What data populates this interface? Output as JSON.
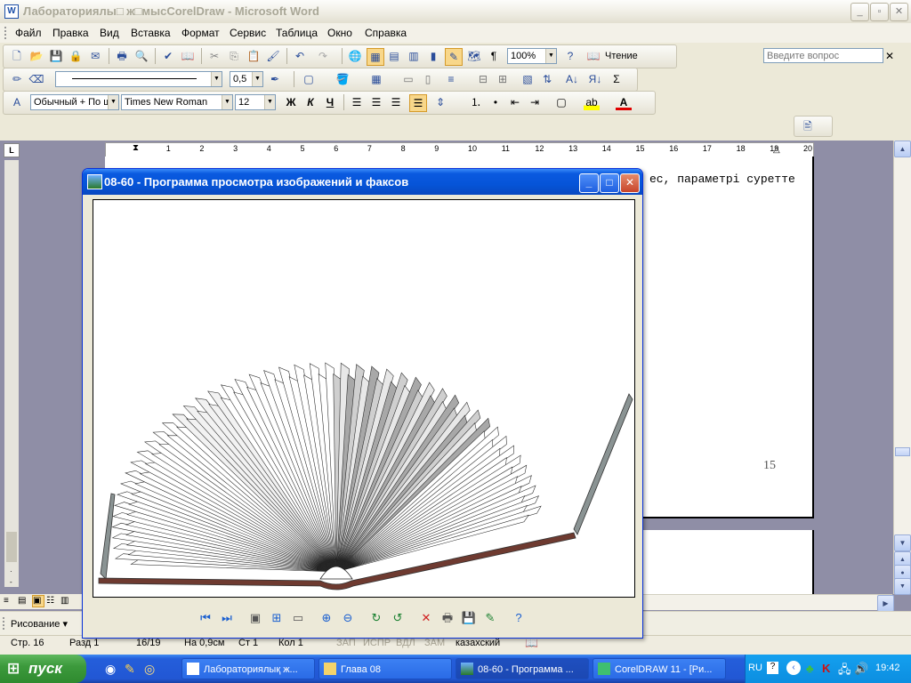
{
  "word": {
    "title": "Лабораториялы□ ж□мысCorelDraw - Microsoft Word",
    "menu": [
      "Файл",
      "Правка",
      "Вид",
      "Вставка",
      "Формат",
      "Сервис",
      "Таблица",
      "Окно",
      "Справка"
    ],
    "ask_placeholder": "Введите вопрос",
    "zoom": "100%",
    "reading_label": "Чтение",
    "line_weight": "0,5",
    "style": "Обычный + По ш",
    "font": "Times New Roman",
    "font_size": "12",
    "drawing_label": "Рисование ▾",
    "ruler_numbers": [
      "1",
      "2",
      "3",
      "4",
      "5",
      "6",
      "7",
      "8",
      "9",
      "10",
      "11",
      "12",
      "13",
      "14",
      "15",
      "16",
      "17",
      "18",
      "19",
      "20"
    ]
  },
  "document": {
    "text_fragment": "ес, параметрі суретте",
    "page_number": "15"
  },
  "status": {
    "page": "Стр. 16",
    "section": "Разд 1",
    "pages": "16/19",
    "at": "На 0,9см",
    "line": "Ст 1",
    "col": "Кол 1",
    "rec": "ЗАП",
    "trk": "ИСПР",
    "ext": "ВДЛ",
    "ovr": "ЗАМ",
    "lang": "казахский"
  },
  "viewer": {
    "title": "08-60 - Программа просмотра изображений и факсов"
  },
  "taskbar": {
    "start": "пуск",
    "tasks": [
      "Лабораториялық ж...",
      "Глава 08",
      "08-60 - Программа ...",
      "CorelDRAW 11 - [Ри..."
    ],
    "lang": "RU",
    "clock": "19:42"
  },
  "colors": {
    "title_active": "#0654d8",
    "taskbar": "#245edb",
    "start": "#3c9a3c",
    "doc_bg": "#8f8ea6"
  }
}
